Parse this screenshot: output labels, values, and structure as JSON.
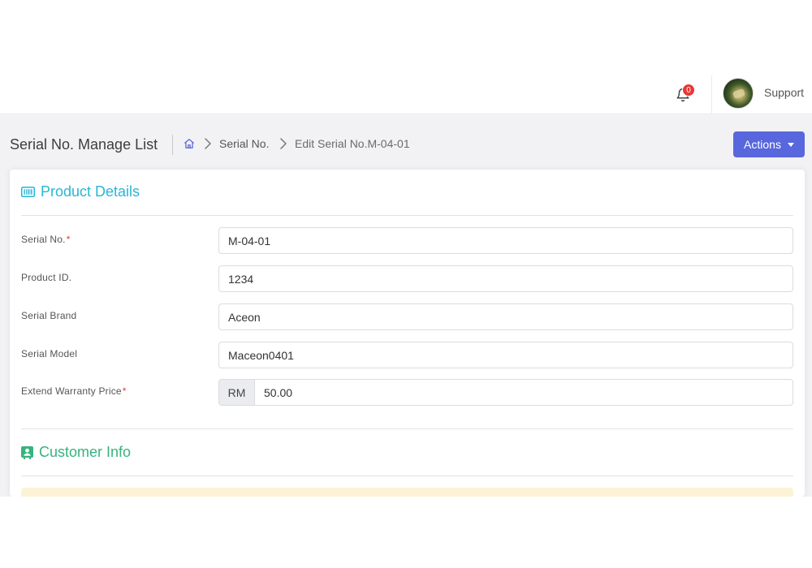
{
  "topbar": {
    "notifications_count": "0",
    "user_name": "Support"
  },
  "subheader": {
    "page_title": "Serial No. Manage List",
    "breadcrumb": {
      "link": "Serial No.",
      "current": "Edit Serial No.M-04-01"
    },
    "actions_label": "Actions"
  },
  "product_details": {
    "title": "Product Details",
    "fields": {
      "serial_no": {
        "label": "Serial No.",
        "required": "*",
        "value": "M-04-01"
      },
      "product_id": {
        "label": "Product ID.",
        "value": "1234"
      },
      "serial_brand": {
        "label": "Serial Brand",
        "value": "Aceon"
      },
      "serial_model": {
        "label": "Serial Model",
        "value": "Maceon0401"
      },
      "extend_warranty_price": {
        "label": "Extend Warranty Price",
        "required": "*",
        "currency": "RM",
        "value": "50.00"
      }
    }
  },
  "customer_info": {
    "title": "Customer Info"
  },
  "colors": {
    "accent": "#5867dd",
    "product_details": "#29b6d6",
    "customer_info": "#36b37e",
    "required": "#e53935",
    "alert_bg": "#fcf3d6"
  },
  "icons": {
    "bell": "bell-icon",
    "home": "home-icon",
    "breadcrumb_separator": "chevron-right-icon",
    "product_details": "barcode-icon",
    "customer_info": "contact-card-icon",
    "actions_caret": "caret-down-icon"
  }
}
